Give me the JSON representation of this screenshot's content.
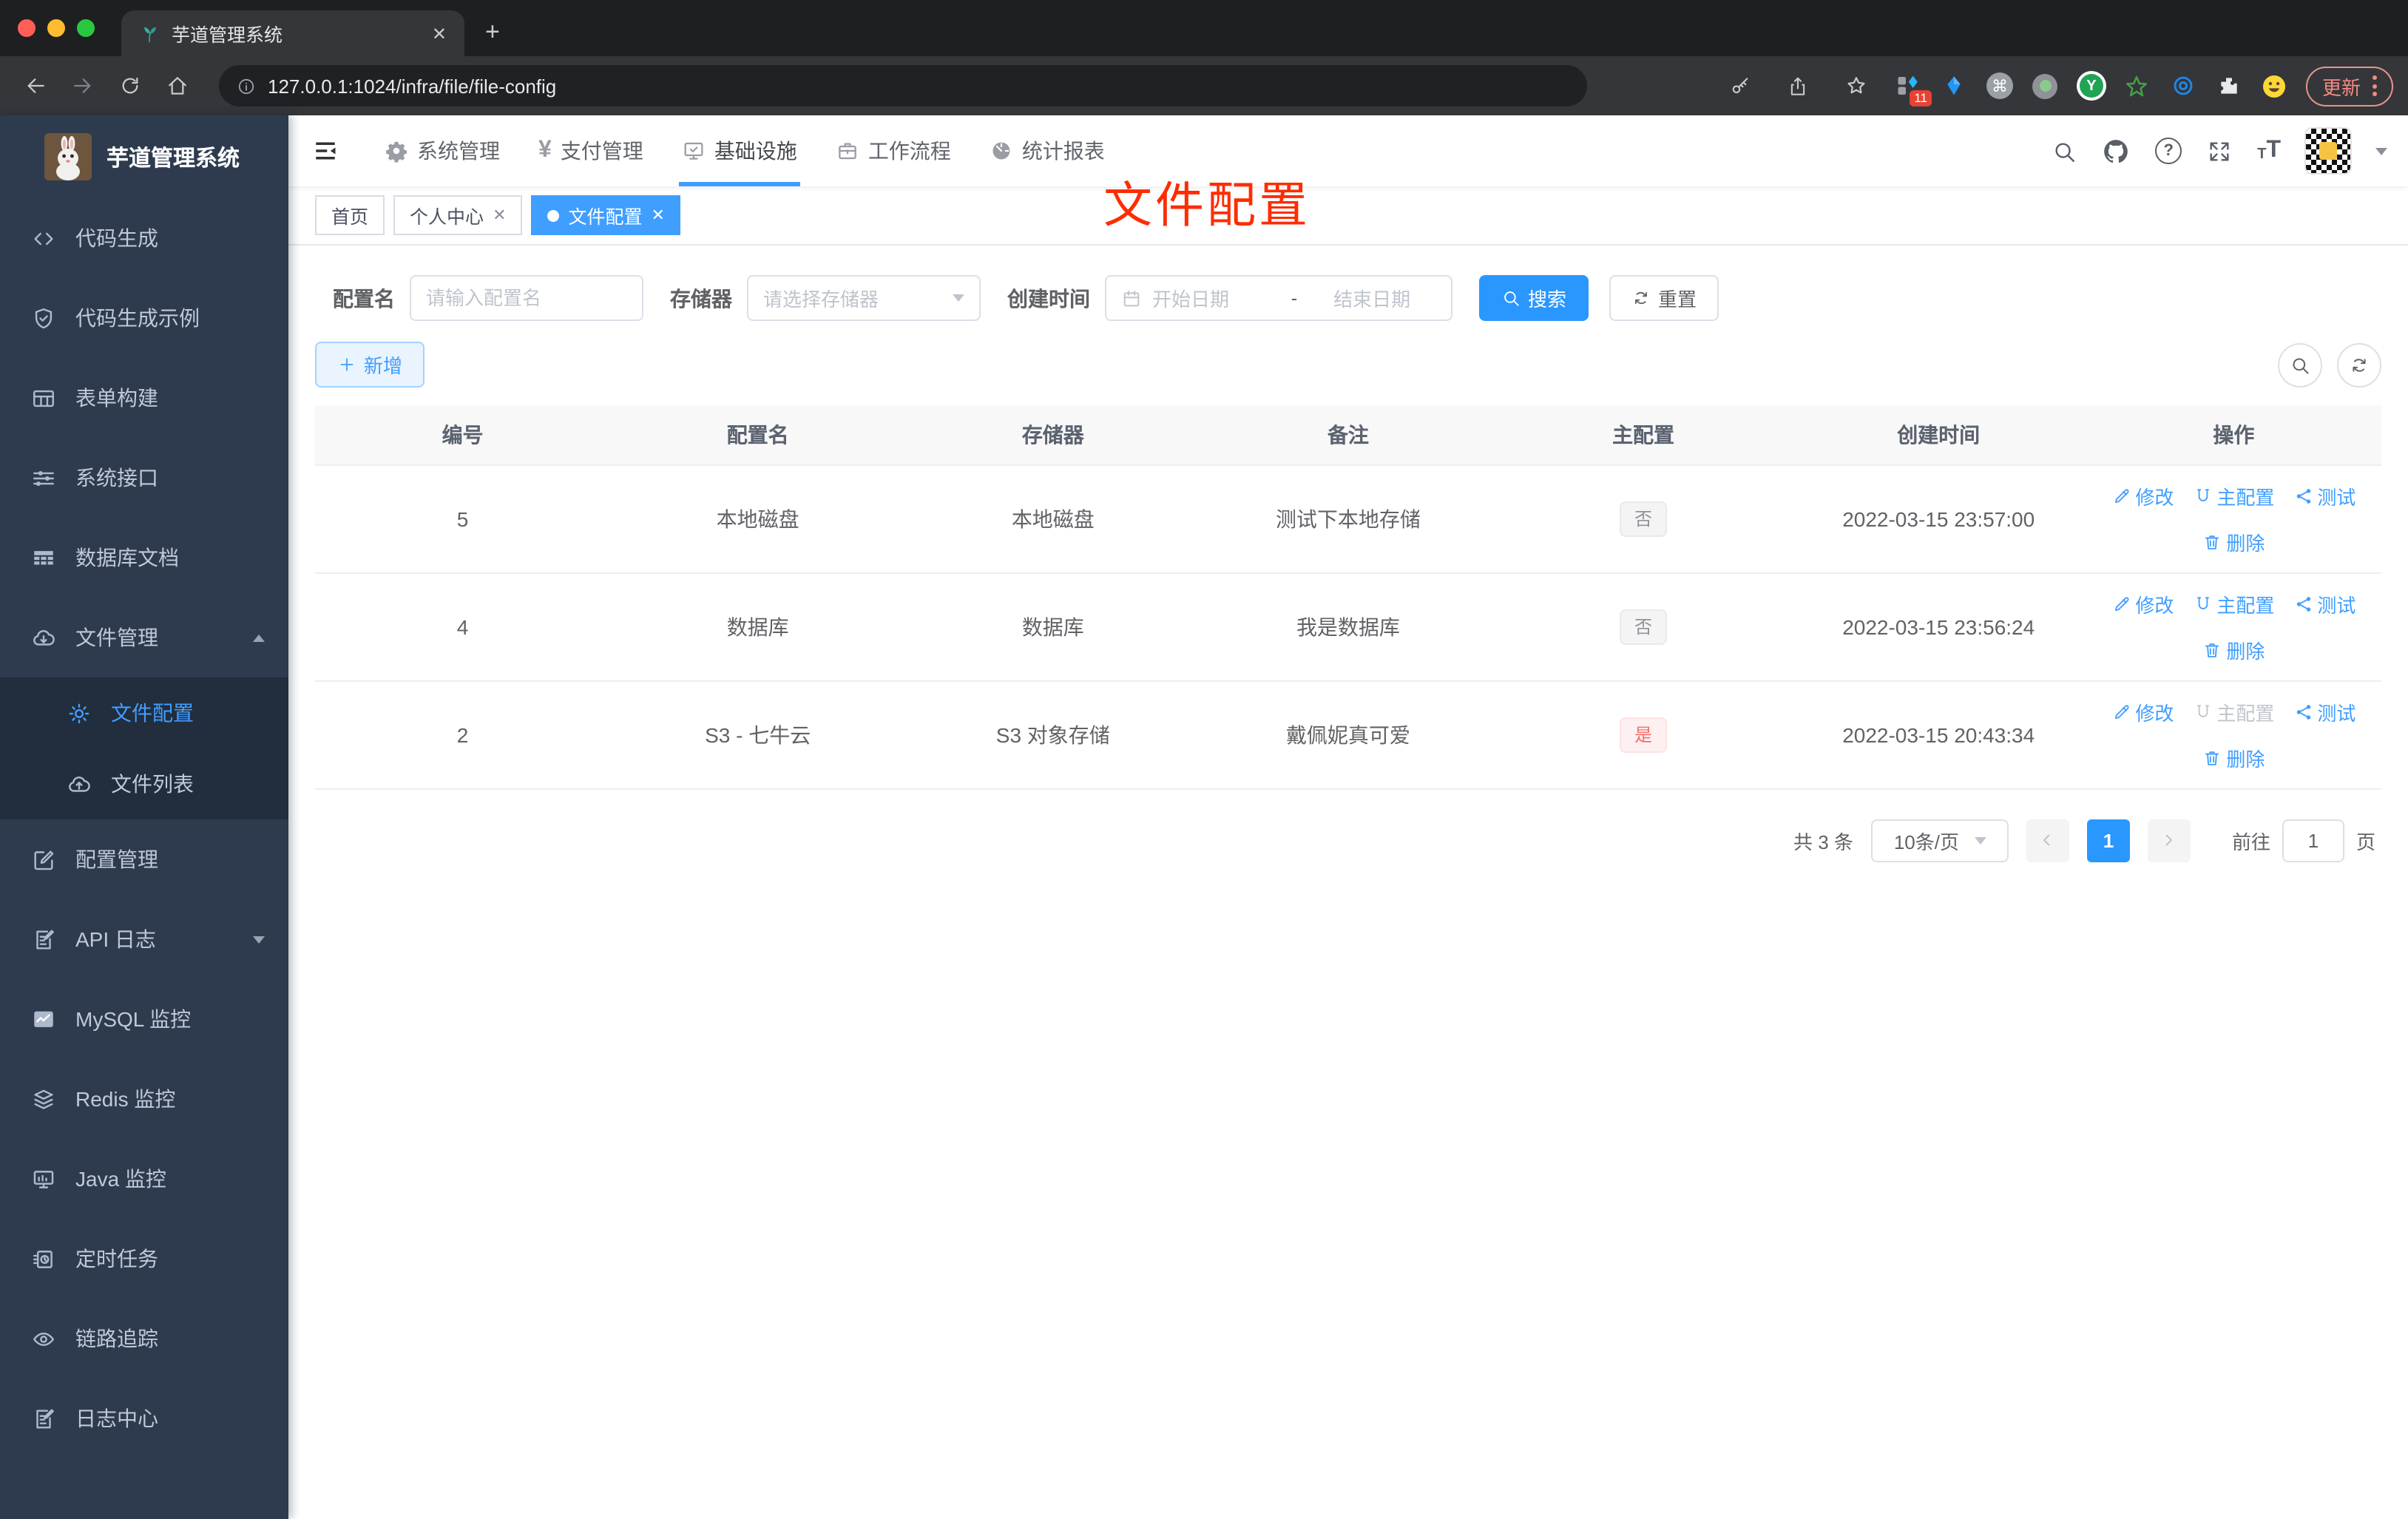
{
  "browser": {
    "tab_title": "芋道管理系统",
    "new_tab_glyph": "+",
    "tab_close_glyph": "✕",
    "url": "127.0.0.1:1024/infra/file/file-config",
    "extension_badge": "11",
    "update_label": "更新"
  },
  "icons": {
    "help_glyph": "?",
    "yen_glyph": "¥",
    "cmd_glyph": "⌘",
    "font_small": "T",
    "font_large": "T",
    "y_glyph": "Y"
  },
  "sidebar": {
    "title": "芋道管理系统",
    "items": [
      {
        "label": "代码生成"
      },
      {
        "label": "代码生成示例"
      },
      {
        "label": "表单构建"
      },
      {
        "label": "系统接口"
      },
      {
        "label": "数据库文档"
      },
      {
        "label": "文件管理"
      },
      {
        "label": "文件配置"
      },
      {
        "label": "文件列表"
      },
      {
        "label": "配置管理"
      },
      {
        "label": "API 日志"
      },
      {
        "label": "MySQL 监控"
      },
      {
        "label": "Redis 监控"
      },
      {
        "label": "Java 监控"
      },
      {
        "label": "定时任务"
      },
      {
        "label": "链路追踪"
      },
      {
        "label": "日志中心"
      }
    ]
  },
  "topnav": {
    "items": [
      {
        "label": "系统管理"
      },
      {
        "label": "支付管理"
      },
      {
        "label": "基础设施"
      },
      {
        "label": "工作流程"
      },
      {
        "label": "统计报表"
      }
    ]
  },
  "tabs": [
    {
      "label": "首页"
    },
    {
      "label": "个人中心"
    },
    {
      "label": "文件配置"
    }
  ],
  "annotation": "文件配置",
  "filters": {
    "name_label": "配置名",
    "name_placeholder": "请输入配置名",
    "storage_label": "存储器",
    "storage_placeholder": "请选择存储器",
    "time_label": "创建时间",
    "start_placeholder": "开始日期",
    "range_separator": "-",
    "end_placeholder": "结束日期",
    "search_label": "搜索",
    "reset_label": "重置"
  },
  "toolbar": {
    "add_label": "新增"
  },
  "table": {
    "columns": [
      "编号",
      "配置名",
      "存储器",
      "备注",
      "主配置",
      "创建时间",
      "操作"
    ],
    "actions": {
      "edit": "修改",
      "primary": "主配置",
      "test": "测试",
      "delete": "删除"
    },
    "rows": [
      {
        "id": "5",
        "name": "本地磁盘",
        "storage": "本地磁盘",
        "remark": "测试下本地存储",
        "primary": "否",
        "created": "2022-03-15 23:57:00"
      },
      {
        "id": "4",
        "name": "数据库",
        "storage": "数据库",
        "remark": "我是数据库",
        "primary": "否",
        "created": "2022-03-15 23:56:24"
      },
      {
        "id": "2",
        "name": "S3 - 七牛云",
        "storage": "S3 对象存储",
        "remark": "戴佩妮真可爱",
        "primary": "是",
        "created": "2022-03-15 20:43:34"
      }
    ]
  },
  "pagination": {
    "total": "共 3 条",
    "page_size": "10条/页",
    "page": "1",
    "page_input": "1",
    "goto_label": "前往",
    "unit_label": "页"
  },
  "colors": {
    "accent": "#409eff",
    "danger": "#f56c6c",
    "sidebar_bg": "#2e3b4e",
    "annotation_red": "#fe2c00"
  }
}
